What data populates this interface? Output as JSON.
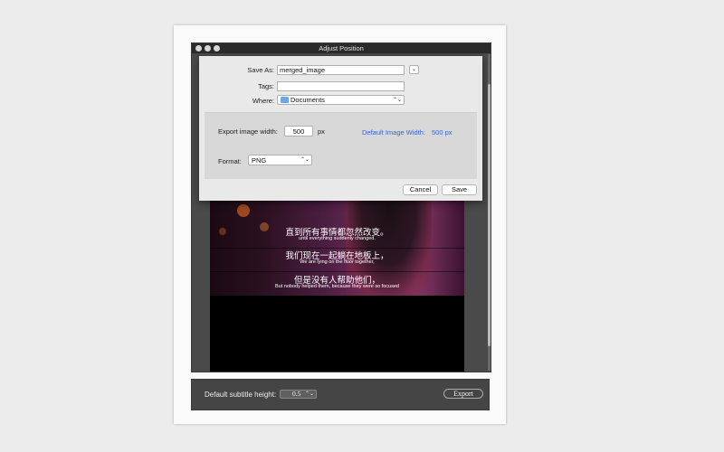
{
  "window": {
    "title": "Adjust Position"
  },
  "dialog": {
    "save_as_label": "Save As:",
    "save_as_value": "merged_image",
    "tags_label": "Tags:",
    "tags_value": "",
    "where_label": "Where:",
    "where_value": "Documents",
    "export_width_label": "Export image width:",
    "export_width_value": "500",
    "px_unit": "px",
    "default_width_label": "Default Image Width:",
    "default_width_value": "500 px",
    "format_label": "Format:",
    "format_value": "PNG",
    "cancel_label": "Cancel",
    "save_label": "Save"
  },
  "subtitles": [
    {
      "zh": "直到所有事情都忽然改变。",
      "en": "until everything suddenly changed."
    },
    {
      "zh": "我们现在一起躺在地板上，",
      "en": "We are lying on the floor together,"
    },
    {
      "zh": "但是没有人帮助他们，",
      "en": "But nobody helped them, because they were so focused"
    }
  ],
  "bottom": {
    "subtitle_height_label": "Default subtitle height:",
    "subtitle_height_value": "0.5",
    "export_label": "Export"
  },
  "colors": {
    "link_blue": "#3a64d6",
    "title_bar": "#2b2b2b",
    "bottom_bar": "#454545"
  },
  "icons": {
    "folder": "folder-icon",
    "chevron": "chevron-down-icon",
    "updown": "updown-arrows-icon"
  }
}
